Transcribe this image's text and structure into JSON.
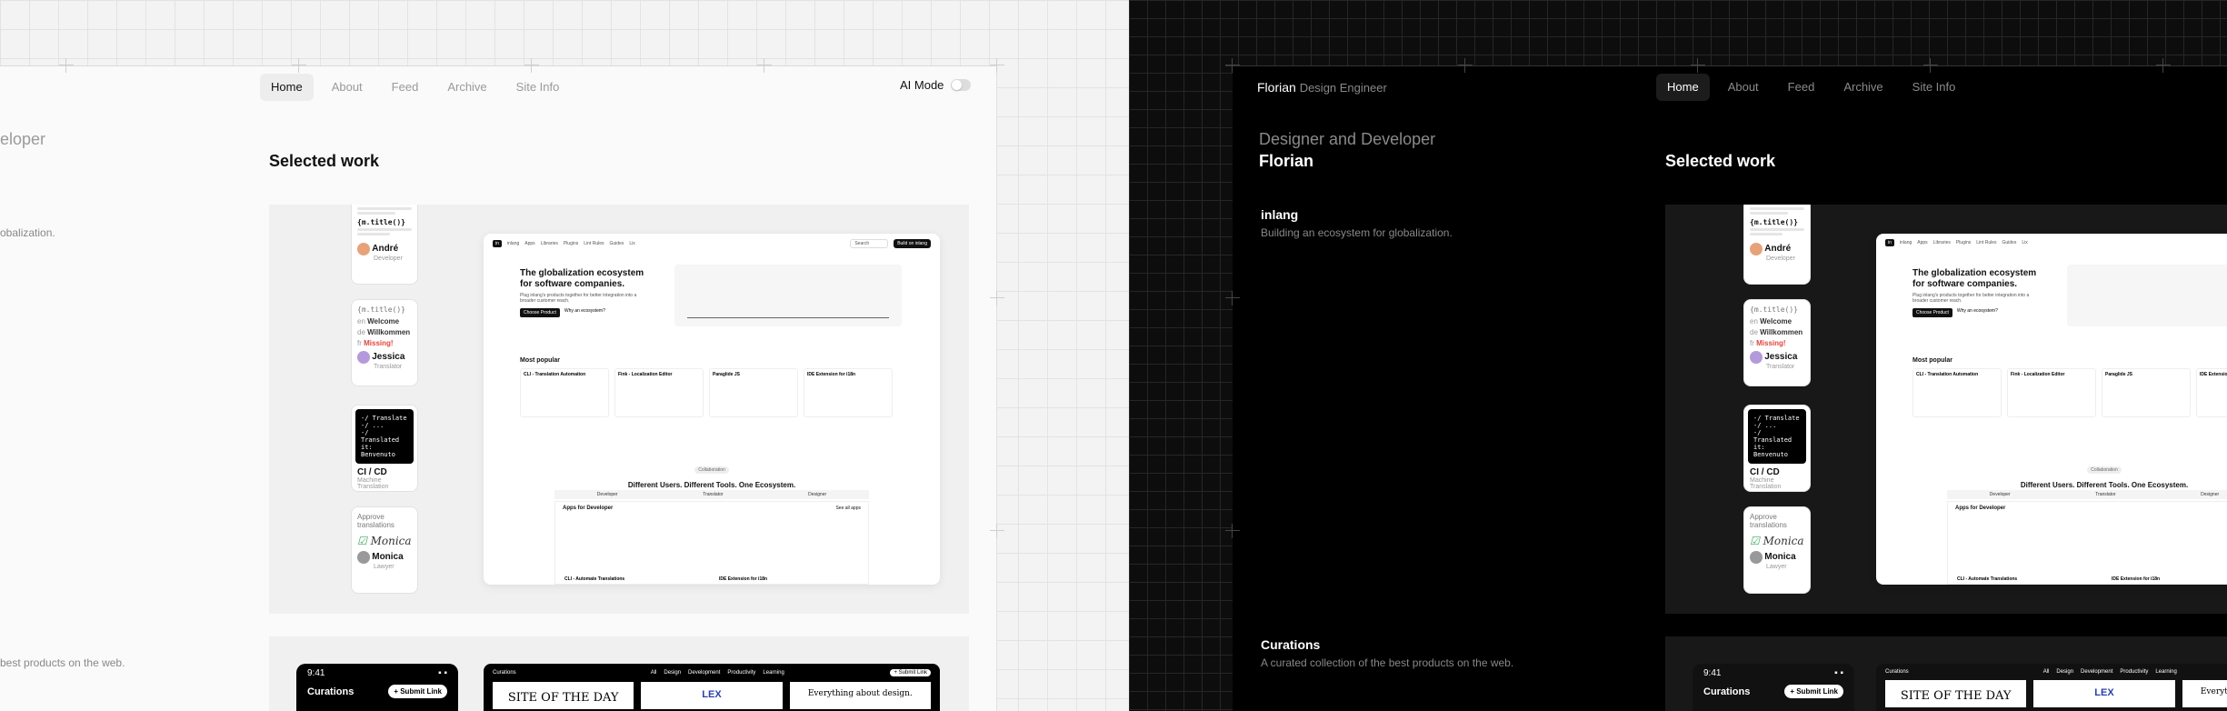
{
  "nav": {
    "items": [
      "Home",
      "About",
      "Feed",
      "Archive",
      "Site Info"
    ],
    "active": "Home",
    "ai_mode": "AI Mode"
  },
  "header": {
    "name": "Florian",
    "role": "Design Engineer",
    "tagline_light": "eloper",
    "tagline": "Designer and Developer",
    "title": "Florian"
  },
  "selected_work": "Selected work",
  "projects": [
    {
      "name": "inlang",
      "desc": "Building an ecosystem for globalization.",
      "desc_light": "obalization."
    },
    {
      "name": "Curations",
      "desc": "A curated collection of the best products on the web.",
      "desc_light": "best products on the web."
    }
  ],
  "cards": {
    "c1": {
      "code": "{m.title()}",
      "name": "André",
      "role": "Developer"
    },
    "c2": {
      "code": "{m.title()}",
      "rows": [
        {
          "lang": "en",
          "text": "Welcome"
        },
        {
          "lang": "de",
          "text": "Willkommen"
        },
        {
          "lang": "fr",
          "text": "Missing!"
        }
      ],
      "name": "Jessica",
      "role": "Translator"
    },
    "c3": {
      "lines": [
        "-/ Translate",
        "-/ ...",
        "-/ Translated",
        "   it: Benvenuto"
      ],
      "name": "CI / CD",
      "role": "Machine Translation"
    },
    "c4": {
      "title": "Approve translations",
      "sig": "Monica",
      "name": "Monica",
      "role": "Lawyer"
    }
  },
  "browser": {
    "logo": "inlang",
    "menu": [
      "Apps",
      "Libraries",
      "Plugins",
      "Lint Rules",
      "Guides",
      "Lix"
    ],
    "search": "Search",
    "cta": "Build on inlang",
    "hero_title": "The globalization ecosystem for software companies.",
    "hero_sub": "Plug inlang's products together for better integration into a broader customer reach.",
    "btn1": "Choose Product",
    "btn2": "Why an ecosystem?",
    "most_popular": "Most popular",
    "popular": [
      "CLI - Translation Automation",
      "Fink - Localization Editor",
      "Paraglide JS",
      "IDE Extension for i18n"
    ],
    "pill": "Collaboration",
    "section": "Different Users. Different Tools. One Ecosystem.",
    "tabs": [
      "Developer",
      "Translator",
      "Designer"
    ],
    "apps_title": "Apps for Developer",
    "see_all": "See all apps",
    "bottom": [
      "CLI - Automate Translations",
      "IDE Extension for i18n"
    ]
  },
  "curations": {
    "time": "9:41",
    "title": "Curations",
    "submit": "+ Submit Link",
    "site_tabs": [
      "All",
      "Design",
      "Development",
      "Productivity",
      "Learning"
    ],
    "cards": [
      "SITE OF THE DAY",
      "LEX",
      "Everything about design."
    ]
  }
}
